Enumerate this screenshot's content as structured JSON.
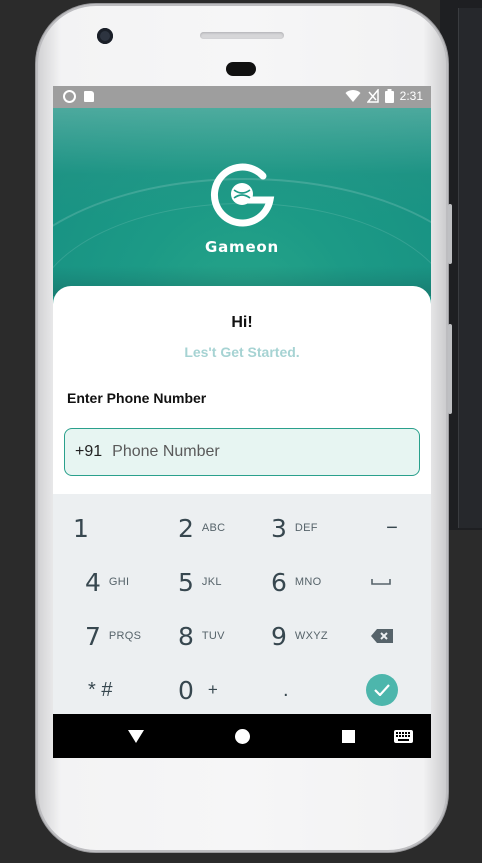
{
  "status_bar": {
    "time": "2:31",
    "left_icons": [
      "circle-icon",
      "sd-card-icon"
    ],
    "right_icons": [
      "wifi-icon",
      "no-signal-icon",
      "battery-icon"
    ]
  },
  "hero": {
    "brand_name": "Gameon",
    "logo_icon": "gameon-logo-icon"
  },
  "greeting": {
    "title": "Hi!",
    "subtitle": "Les't Get Started."
  },
  "phone_form": {
    "label": "Enter Phone Number",
    "country_code": "+91",
    "placeholder": "Phone Number",
    "value": ""
  },
  "keyboard": {
    "rows": [
      [
        {
          "num": "1",
          "letters": ""
        },
        {
          "num": "2",
          "letters": "ABC"
        },
        {
          "num": "3",
          "letters": "DEF"
        },
        {
          "num": "−",
          "letters": ""
        }
      ],
      [
        {
          "num": "4",
          "letters": "GHI"
        },
        {
          "num": "5",
          "letters": "JKL"
        },
        {
          "num": "6",
          "letters": "MNO"
        },
        {
          "num": "space",
          "letters": ""
        }
      ],
      [
        {
          "num": "7",
          "letters": "PRQS"
        },
        {
          "num": "8",
          "letters": "TUV"
        },
        {
          "num": "9",
          "letters": "WXYZ"
        },
        {
          "num": "backspace",
          "letters": ""
        }
      ],
      [
        {
          "num": "* #",
          "letters": ""
        },
        {
          "num": "0",
          "letters": "+"
        },
        {
          "num": ".",
          "letters": ""
        },
        {
          "num": "done",
          "letters": ""
        }
      ]
    ]
  },
  "nav_bar": {
    "items": [
      "back-icon",
      "home-icon",
      "recents-icon",
      "keyboard-icon"
    ]
  },
  "colors": {
    "accent": "#2aa08c",
    "hero": "#1c9a86",
    "subtitle": "#a6d3d3",
    "done_button": "#4db6ac",
    "input_bg": "#e7f5f2"
  }
}
